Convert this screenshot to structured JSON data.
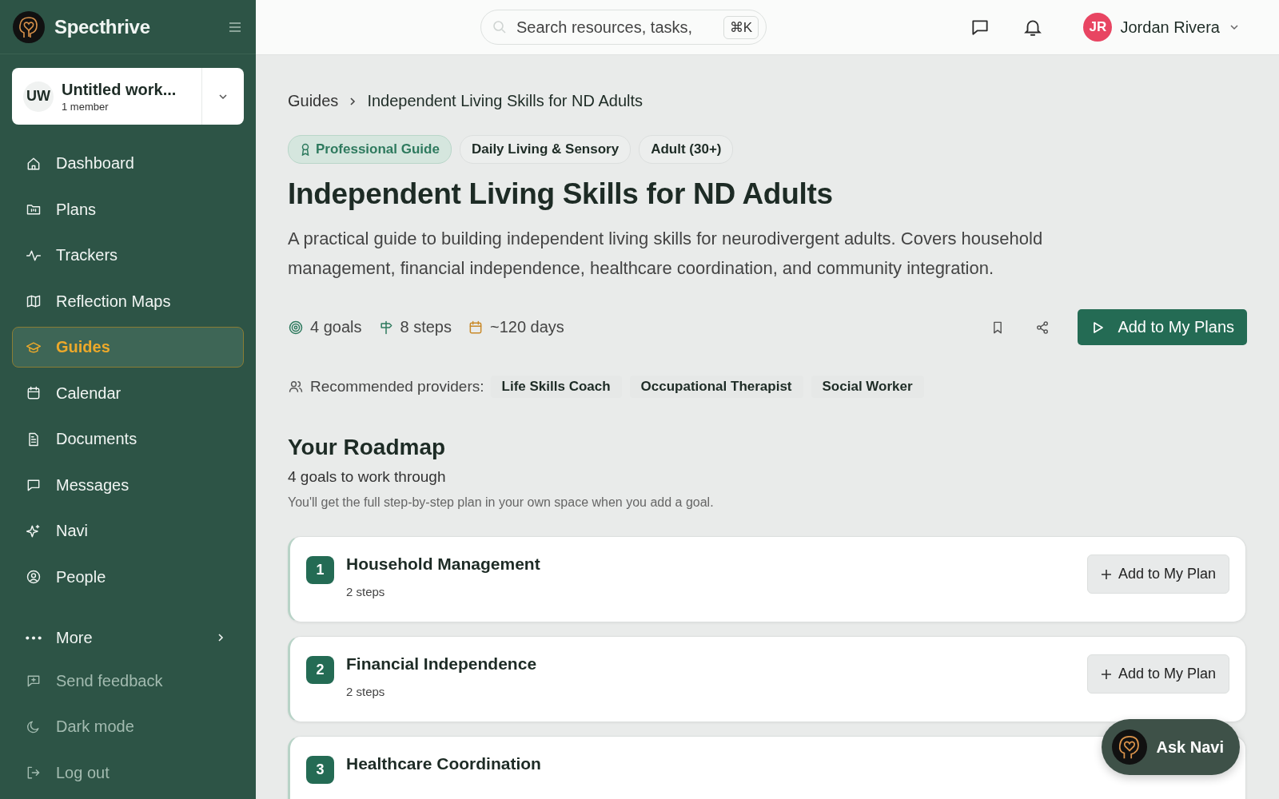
{
  "sidebar": {
    "brand": "Specthrive",
    "workspace": {
      "initials": "UW",
      "name": "Untitled work...",
      "members": "1 member"
    },
    "nav": [
      {
        "label": "Dashboard",
        "selected": false
      },
      {
        "label": "Plans",
        "selected": false
      },
      {
        "label": "Trackers",
        "selected": false
      },
      {
        "label": "Reflection Maps",
        "selected": false
      },
      {
        "label": "Guides",
        "selected": true
      },
      {
        "label": "Calendar",
        "selected": false
      },
      {
        "label": "Documents",
        "selected": false
      },
      {
        "label": "Messages",
        "selected": false
      },
      {
        "label": "Navi",
        "selected": false
      },
      {
        "label": "People",
        "selected": false
      }
    ],
    "more": {
      "label": "More"
    },
    "footer_items": [
      {
        "label": "Send feedback"
      },
      {
        "label": "Dark mode"
      },
      {
        "label": "Log out"
      }
    ]
  },
  "topbar": {
    "search": {
      "placeholder": "Search resources, tasks,",
      "shortcut": "⌘K"
    },
    "user": {
      "initials": "JR",
      "name": "Jordan Rivera"
    }
  },
  "breadcrumb": [
    "Guides",
    "Independent Living Skills for ND Adults"
  ],
  "tags": [
    {
      "label": "Professional Guide",
      "kind": "professional"
    },
    {
      "label": "Daily Living & Sensory",
      "kind": "plain"
    },
    {
      "label": "Adult (30+)",
      "kind": "plain"
    }
  ],
  "title": "Independent Living Skills for ND Adults",
  "description": "A practical guide to building independent living skills for neurodivergent adults. Covers household management, financial independence, healthcare coordination, and community integration.",
  "stats": [
    "4 goals",
    "8 steps",
    "~120 days"
  ],
  "primary_button": "Add to My Plans",
  "providers": {
    "label": "Recommended providers:",
    "items": [
      "Life Skills Coach",
      "Occupational Therapist",
      "Social Worker"
    ]
  },
  "roadmap": {
    "title": "Your Roadmap",
    "subtitle": "4 goals to work through",
    "note": "You'll get the full step-by-step plan in your own space when you add a goal.",
    "goals": [
      {
        "number": "1",
        "title": "Household Management",
        "steps": "2 steps",
        "button": "Add to My Plan"
      },
      {
        "number": "2",
        "title": "Financial Independence",
        "steps": "2 steps",
        "button": "Add to My Plan"
      },
      {
        "number": "3",
        "title": "Healthcare Coordination"
      }
    ]
  },
  "ask_navi": "Ask Navi"
}
